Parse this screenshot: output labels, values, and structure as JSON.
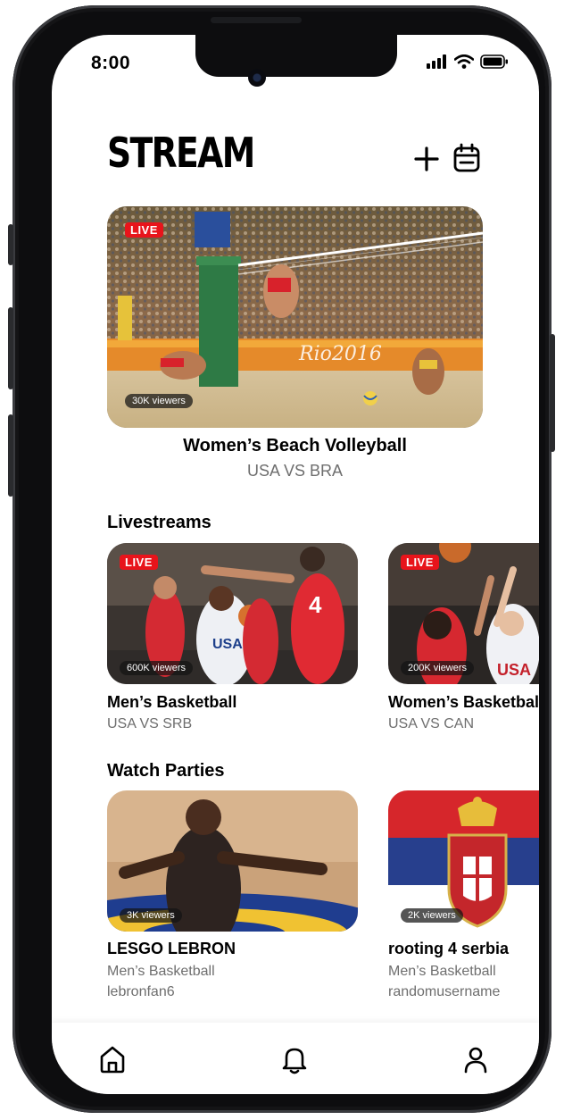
{
  "status": {
    "time": "8:00"
  },
  "header": {
    "title": "STREAM"
  },
  "featured": {
    "live_label": "LIVE",
    "viewers": "30K viewers",
    "title": "Women’s Beach Volleyball",
    "subtitle": "USA VS BRA"
  },
  "livestreams": {
    "section_title": "Livestreams",
    "items": [
      {
        "live_label": "LIVE",
        "viewers": "600K viewers",
        "title": "Men’s Basketball",
        "subtitle": "USA VS SRB"
      },
      {
        "live_label": "LIVE",
        "viewers": "200K viewers",
        "title": "Women’s Basketball",
        "subtitle": "USA VS CAN"
      }
    ]
  },
  "watch_parties": {
    "section_title": "Watch Parties",
    "items": [
      {
        "viewers": "3K viewers",
        "title": "LESGO LEBRON",
        "sport": "Men’s Basketball",
        "host": "lebronfan6"
      },
      {
        "viewers": "2K viewers",
        "title": "rooting 4 serbia",
        "sport": "Men’s Basketball",
        "host": "randomusername"
      }
    ]
  },
  "tabbar": {
    "icons": [
      "home-icon",
      "bell-icon",
      "profile-icon"
    ]
  },
  "colors": {
    "live_red": "#e8141b",
    "text_primary": "#000000",
    "text_secondary": "#6e6e6e"
  }
}
